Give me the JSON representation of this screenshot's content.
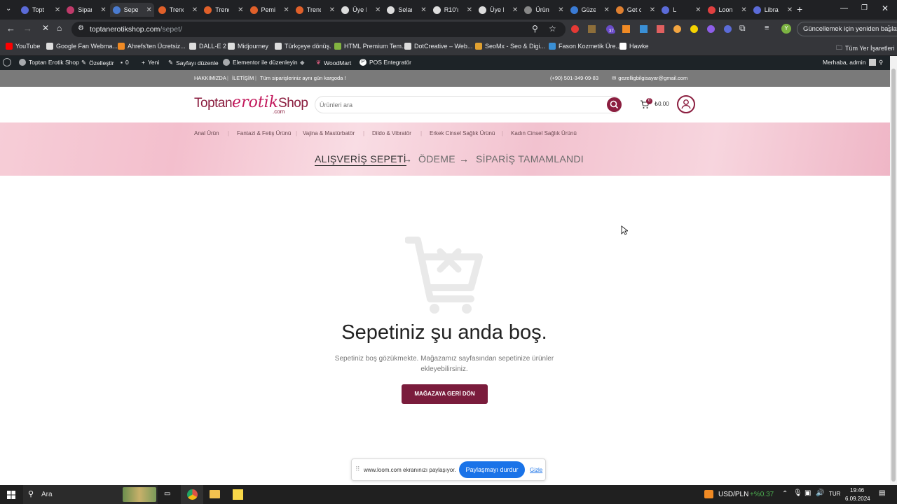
{
  "browser": {
    "tabs": [
      {
        "title": "Topt",
        "color": "#5b6bd8"
      },
      {
        "title": "Sipar",
        "color": "#c03a6a"
      },
      {
        "title": "Sepe",
        "color": "#4a7bd0"
      },
      {
        "title": "Trenc",
        "color": "#e0602a"
      },
      {
        "title": "Trenc",
        "color": "#e0602a"
      },
      {
        "title": "Pemi",
        "color": "#e0602a"
      },
      {
        "title": "Trenc",
        "color": "#e0602a"
      },
      {
        "title": "Üye I",
        "color": "#dddddd"
      },
      {
        "title": "Selan",
        "color": "#dddddd"
      },
      {
        "title": "R10'ı",
        "color": "#dddddd"
      },
      {
        "title": "Üye I",
        "color": "#dddddd"
      },
      {
        "title": "Ürün",
        "color": "#888888"
      },
      {
        "title": "Güze",
        "color": "#3a7bd5"
      },
      {
        "title": "Get c",
        "color": "#e08030"
      },
      {
        "title": "L",
        "color": "#5b6bd8"
      },
      {
        "title": "Loon",
        "color": "#e04040"
      },
      {
        "title": "Libra",
        "color": "#5b6bd8"
      }
    ],
    "url_host": "toptanerotikshop.com",
    "url_path": "/sepet/",
    "update_label": "Güncellemek için yeniden başlat",
    "profile_letter": "Y",
    "ext_badge": "37",
    "bookmarks": [
      {
        "label": "YouTube",
        "color": "#ff0000"
      },
      {
        "label": "Google Fan Webma...",
        "color": "#dddddd"
      },
      {
        "label": "Ahrefs'ten Ücretsiz...",
        "color": "#f08a24"
      },
      {
        "label": "DALL-E 2",
        "color": "#dddddd"
      },
      {
        "label": "Midjourney",
        "color": "#dddddd"
      },
      {
        "label": "Türkçeye dönüş.",
        "color": "#dddddd"
      },
      {
        "label": "HTML Premium Tem...",
        "color": "#82b440"
      },
      {
        "label": "DotCreative – Web...",
        "color": "#dddddd"
      },
      {
        "label": "SeoMx - Seo & Digi...",
        "color": "#e0a030"
      },
      {
        "label": "Fason Kozmetik Üre...",
        "color": "#3a8fd5"
      },
      {
        "label": "Hawke",
        "color": "#ffffff"
      }
    ],
    "all_bookmarks": "Tüm Yer İşaretleri"
  },
  "wp_admin": {
    "site_name": "Toptan Erotik Shop",
    "customize": "Özelleştir",
    "comments": "0",
    "new": "Yeni",
    "edit_page": "Sayfayı düzenle",
    "elementor": "Elementor ile düzenleyin",
    "woodmart": "WoodMart",
    "pos": "POS Entegratör",
    "greeting": "Merhaba, admin"
  },
  "topbar": {
    "about": "HAKKIMIZDA",
    "contact": "İLETİŞİM",
    "notice": "Tüm siparişleriniz aynı gün kargoda !",
    "phone": "(+90) 501-349-09-83",
    "email": "gezelligbilgisayar@gmail.com"
  },
  "header": {
    "logo_part1": "Toptan",
    "logo_part2": "erotik",
    "logo_part3": "Shop",
    "logo_sub": ".com",
    "search_placeholder": "Ürünleri ara",
    "cart_count": "0",
    "cart_total": "₺0.00"
  },
  "nav": [
    "Anal Ürün",
    "Fantazi & Fetiş Ürünü",
    "Vajina & Mastürbatör",
    "Dildo & Vibratör",
    "Erkek Cinsel Sağlık Ürünü",
    "Kadın Cinsel Sağlık Ürünü"
  ],
  "steps": {
    "cart": "ALIŞVERİŞ SEPETİ",
    "checkout": "ÖDEME",
    "complete": "SİPARİŞ TAMAMLANDI"
  },
  "empty_cart": {
    "heading": "Sepetiniz şu anda boş.",
    "message_line1": "Sepetiniz boş gözükmekte. Mağazamız sayfasından sepetinize ürünler",
    "message_line2": "ekleyebilirsiniz.",
    "button": "MAĞAZAYA GERİ DÖN"
  },
  "loom": {
    "sharing_text": "www.loom.com ekranınızı paylaşıyor.",
    "stop_button": "Paylaşmayı durdur",
    "hide": "Gizle"
  },
  "taskbar": {
    "search": "Ara",
    "currency": "USD/PLN",
    "change": "+%0.37",
    "lang": "TUR",
    "time": "19:46",
    "date": "6.09.2024"
  },
  "colors": {
    "brand": "#8b1e3f",
    "button": "#7a1c3c"
  }
}
